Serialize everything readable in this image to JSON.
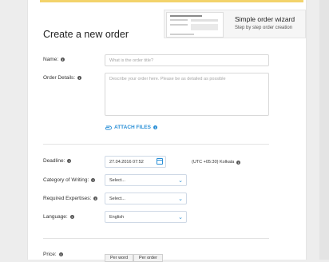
{
  "wizard": {
    "title": "Simple order wizard",
    "subtitle": "Step by step order creation"
  },
  "page_title": "Create a new order",
  "name": {
    "label": "Name:",
    "placeholder": "What is the order title?"
  },
  "details": {
    "label": "Order Details:",
    "placeholder": "Describe your order here. Please be as detailed as possible"
  },
  "attach": {
    "label": "ATTACH FILES"
  },
  "deadline": {
    "label": "Deadline:",
    "value": "27.04.2016 07:52",
    "timezone": "(UTC +05:30) Kolkata"
  },
  "category": {
    "label": "Category of Writing:",
    "value": "Select..."
  },
  "expertises": {
    "label": "Required Expertises:",
    "value": "Select..."
  },
  "language": {
    "label": "Language:",
    "value": "English"
  },
  "price": {
    "label": "Price:",
    "tabs": [
      "Per word",
      "Per order"
    ]
  },
  "colors": {
    "accent": "#2a8fd6",
    "topbar": "#f3d36b"
  }
}
